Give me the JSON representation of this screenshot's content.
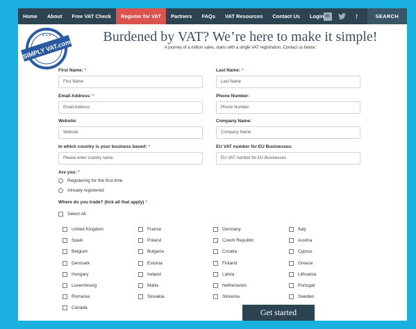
{
  "nav": {
    "items": [
      "Home",
      "About",
      "Free VAT Check",
      "Register for VAT",
      "Partners",
      "FAQs",
      "VAT Resources",
      "Contact Us",
      "Login"
    ],
    "active": "Register for VAT",
    "search_label": "SEARCH",
    "social": [
      "linkedin-icon",
      "twitter-icon",
      "facebook-icon"
    ]
  },
  "logo": {
    "text": "SIMPLY VAT.com"
  },
  "header": {
    "title": "Burdened by VAT? We’re here to make it simple!",
    "subtitle": "A journey of a million sales, starts with a single VAT registration. Contact us below:"
  },
  "form": {
    "first_name": {
      "label": "First Name:",
      "placeholder": "First Name"
    },
    "last_name": {
      "label": "Last Name:",
      "placeholder": "Last Name"
    },
    "email": {
      "label": "Email Address:",
      "placeholder": "Email Address"
    },
    "phone": {
      "label": "Phone Number:",
      "placeholder": "Phone Number"
    },
    "website": {
      "label": "Website:",
      "placeholder": "Website"
    },
    "company": {
      "label": "Company Name:",
      "placeholder": "Company Name"
    },
    "country": {
      "label": "In which country is your business based:",
      "placeholder": "Please enter country name"
    },
    "eu_vat": {
      "label": "EU VAT number for EU Businesses:",
      "placeholder": "EU VAT number for EU Businesses"
    },
    "are_you": {
      "label": "Are you:",
      "options": [
        "Registering for the first time",
        "Already registered"
      ]
    },
    "trade": {
      "label": "Where do you trade? (tick all that apply)",
      "select_all": "Select All",
      "countries": [
        [
          "United Kingdom",
          "France",
          "Germany",
          "Italy"
        ],
        [
          "Spain",
          "Poland",
          "Czech Republic",
          "Austria"
        ],
        [
          "Belgium",
          "Bulgaria",
          "Croatia",
          "Cyprus"
        ],
        [
          "Denmark",
          "Estonia",
          "Finland",
          "Greece"
        ],
        [
          "Hungary",
          "Ireland",
          "Latvia",
          "Lithuania"
        ],
        [
          "Luxembourg",
          "Malta",
          "Netherlands",
          "Portugal"
        ],
        [
          "Romania",
          "Slovakia",
          "Slovenia",
          "Sweden"
        ],
        [
          "Canada"
        ]
      ]
    },
    "required_marker": "*",
    "submit_label": "Get started"
  }
}
